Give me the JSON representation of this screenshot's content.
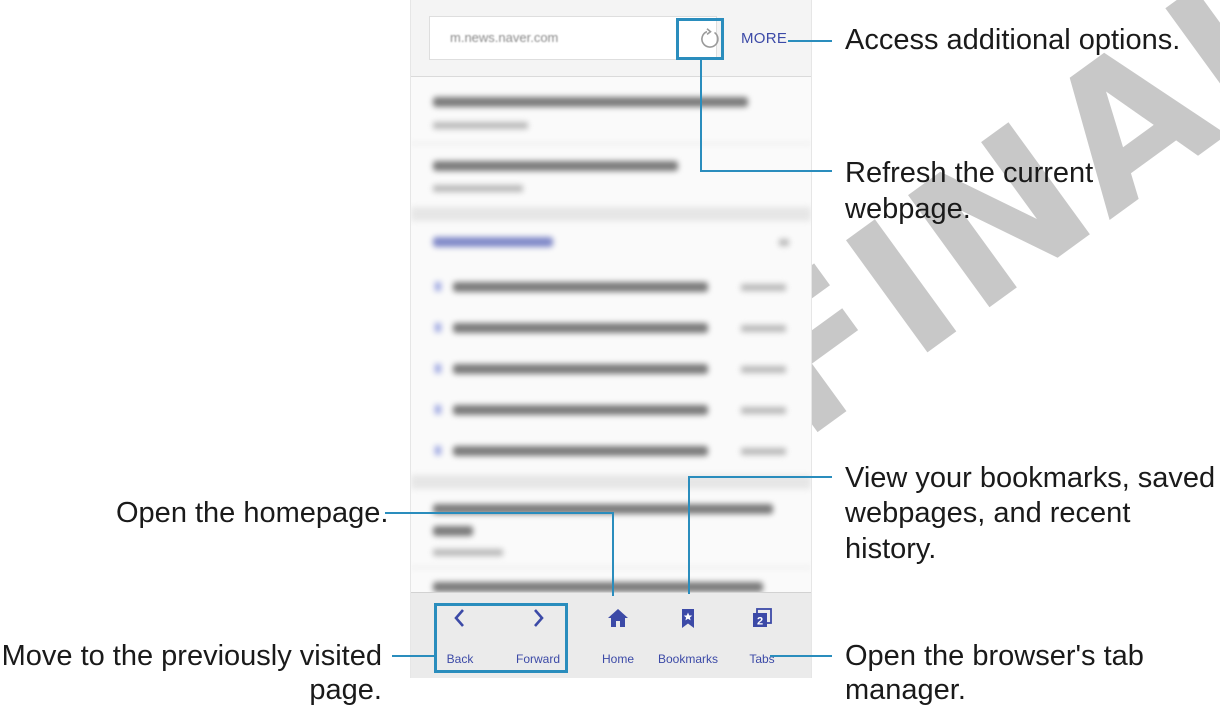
{
  "watermark": "FINAL",
  "browser": {
    "url": "m.news.naver.com",
    "more_label": "MORE"
  },
  "nav": {
    "back": "Back",
    "forward": "Forward",
    "home": "Home",
    "bookmarks": "Bookmarks",
    "tabs": "Tabs",
    "tab_count": "2"
  },
  "callouts": {
    "more": "Access additional options.",
    "refresh": "Refresh the current webpage.",
    "bookmarks_line1": "View your bookmarks, saved",
    "bookmarks_line2": "webpages, and recent history.",
    "home": "Open the homepage.",
    "back_line1": "Move to the previously visited",
    "back_line2": "page.",
    "tabs_line1": "Open the browser's tab",
    "tabs_line2": "manager."
  },
  "colors": {
    "accent": "#3c4aa7",
    "callout_line": "#2a8dbd"
  }
}
